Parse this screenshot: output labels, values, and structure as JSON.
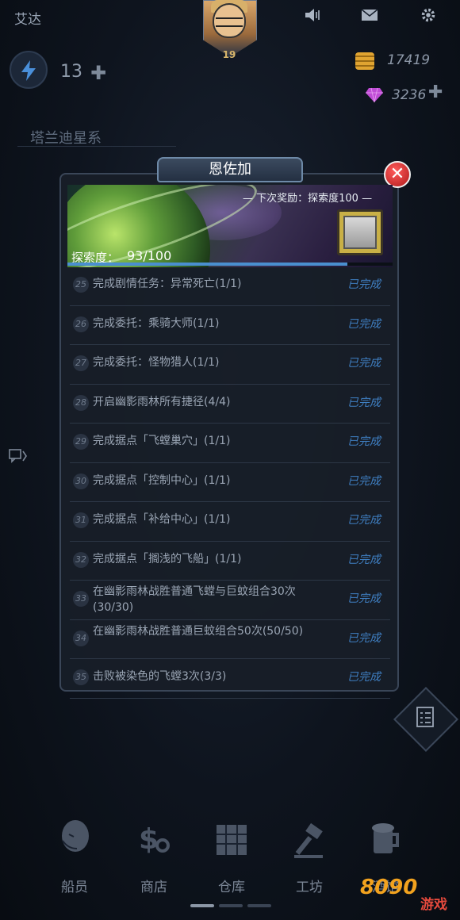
{
  "top": {
    "player_name": "艾达",
    "avatar_level": "19",
    "energy": "13",
    "coins": "17419",
    "gems": "3236",
    "galaxy": "塔兰迪星系",
    "icons": [
      "speaker-icon",
      "mail-icon",
      "gear-icon",
      "energy-bolt-icon",
      "coin-stack-icon",
      "gem-icon"
    ]
  },
  "modal": {
    "title": "恩佐加",
    "next_reward": "— 下次奖励：探索度100 —",
    "explore_label": "探索度：",
    "explore_value": "93/100",
    "progress": 0.93,
    "tasks": [
      {
        "num": "25",
        "text": "完成剧情任务：异常死亡(1/1)",
        "status": "已完成"
      },
      {
        "num": "26",
        "text": "完成委托：乘骑大师(1/1)",
        "status": "已完成"
      },
      {
        "num": "27",
        "text": "完成委托：怪物猎人(1/1)",
        "status": "已完成"
      },
      {
        "num": "28",
        "text": "开启幽影雨林所有捷径(4/4)",
        "status": "已完成"
      },
      {
        "num": "29",
        "text": "完成据点「飞螳巢穴」(1/1)",
        "status": "已完成"
      },
      {
        "num": "30",
        "text": "完成据点「控制中心」(1/1)",
        "status": "已完成"
      },
      {
        "num": "31",
        "text": "完成据点「补给中心」(1/1)",
        "status": "已完成"
      },
      {
        "num": "32",
        "text": "完成据点「搁浅的飞船」(1/1)",
        "status": "已完成"
      },
      {
        "num": "33",
        "text": "在幽影雨林战胜普通飞螳与巨蚊组合30次(30/30)",
        "status": "已完成"
      },
      {
        "num": "34",
        "text": "在幽影雨林战胜普通巨蚊组合50次(50/50)",
        "status": "已完成"
      },
      {
        "num": "35",
        "text": "击败被染色的飞螳3次(3/3)",
        "status": "已完成"
      }
    ]
  },
  "nav": {
    "items": [
      {
        "label": "船员",
        "icon": "crew-icon"
      },
      {
        "label": "商店",
        "icon": "shop-icon"
      },
      {
        "label": "仓库",
        "icon": "warehouse-icon"
      },
      {
        "label": "工坊",
        "icon": "workshop-icon"
      },
      {
        "label": "酒馆",
        "icon": "tavern-icon"
      }
    ]
  },
  "watermark": {
    "logo": "8090",
    "sub": "游戏"
  },
  "colors": {
    "accent": "#3f7fc2",
    "close": "#c72424",
    "coin": "#e0a431",
    "gem": "#c04bd6"
  }
}
